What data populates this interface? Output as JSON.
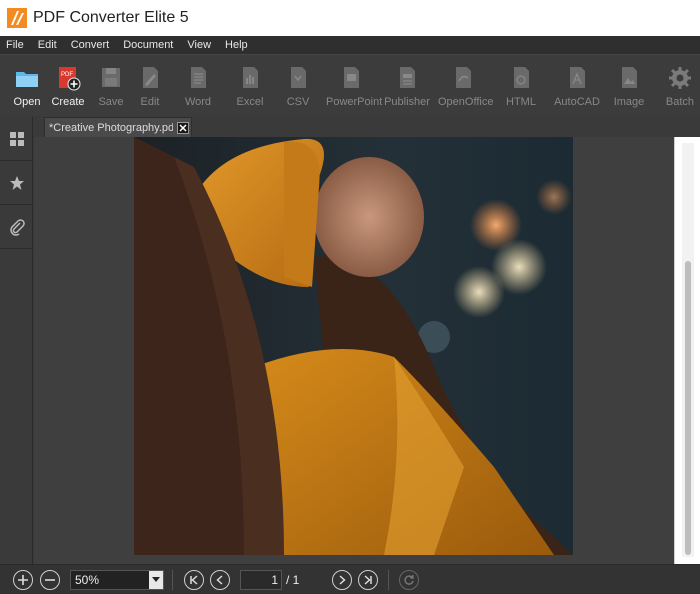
{
  "window": {
    "title": "PDF Converter Elite 5"
  },
  "menu": [
    "File",
    "Edit",
    "Convert",
    "Document",
    "View",
    "Help"
  ],
  "toolbar": {
    "items": [
      {
        "label": "Open",
        "icon": "folder-icon",
        "enabled": true
      },
      {
        "label": "Create",
        "icon": "create-pdf-icon",
        "enabled": true
      },
      {
        "label": "Save",
        "icon": "save-icon",
        "enabled": false
      },
      {
        "label": "Edit",
        "icon": "edit-icon",
        "enabled": false
      },
      {
        "label": "Word",
        "icon": "word-doc-icon",
        "enabled": false
      },
      {
        "label": "Excel",
        "icon": "excel-doc-icon",
        "enabled": false
      },
      {
        "label": "CSV",
        "icon": "csv-doc-icon",
        "enabled": false
      },
      {
        "label": "PowerPoint",
        "icon": "powerpoint-doc-icon",
        "enabled": false
      },
      {
        "label": "Publisher",
        "icon": "publisher-doc-icon",
        "enabled": false
      },
      {
        "label": "OpenOffice",
        "icon": "openoffice-doc-icon",
        "enabled": false
      },
      {
        "label": "HTML",
        "icon": "html-doc-icon",
        "enabled": false
      },
      {
        "label": "AutoCAD",
        "icon": "autocad-doc-icon",
        "enabled": false
      },
      {
        "label": "Image",
        "icon": "image-doc-icon",
        "enabled": false
      },
      {
        "label": "Batch",
        "icon": "batch-gear-icon",
        "enabled": false
      }
    ],
    "create_badge": "PDF"
  },
  "document_tab": {
    "label": "*Creative Photography.pdf"
  },
  "statusbar": {
    "zoom": "50%",
    "current_page": "1",
    "page_total": "/ 1"
  },
  "colors": {
    "accent_orange": "#f08a24",
    "toolbar_bg": "#3c3c3c",
    "menubar_bg": "#2f2f2f"
  }
}
